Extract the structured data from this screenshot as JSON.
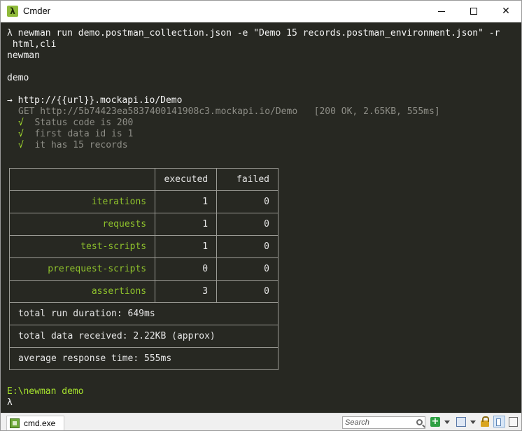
{
  "window": {
    "title": "Cmder",
    "app_icon_glyph": "λ",
    "controls": {
      "minimize": "minimize-icon",
      "maximize": "maximize-icon",
      "close": "close-icon"
    }
  },
  "console": {
    "prompt_glyph": "λ",
    "command_line1": "newman run demo.postman_collection.json -e \"Demo 15 records.postman_environment.json\" -r",
    "command_line2": " html,cli",
    "output_newman": "newman",
    "collection_name": "demo",
    "request_arrow": "→",
    "request_name": "http://{{url}}.mockapi.io/Demo",
    "request_detail": "GET http://5b74423ea5837400141908c3.mockapi.io/Demo   [200 OK, 2.65KB, 555ms]",
    "check_glyph": "√",
    "assertions": [
      "Status code is 200",
      "first data id is 1",
      "it has 15 records"
    ],
    "summary": {
      "headers": [
        "",
        "executed",
        "failed"
      ],
      "rows": [
        {
          "name": "iterations",
          "executed": "1",
          "failed": "0"
        },
        {
          "name": "requests",
          "executed": "1",
          "failed": "0"
        },
        {
          "name": "test-scripts",
          "executed": "1",
          "failed": "0"
        },
        {
          "name": "prerequest-scripts",
          "executed": "0",
          "failed": "0"
        },
        {
          "name": "assertions",
          "executed": "3",
          "failed": "0"
        }
      ],
      "total_run_duration": "total run duration: 649ms",
      "total_data_received": "total data received: 2.22KB (approx)",
      "average_response_time": "average response time: 555ms"
    },
    "final_path": "E:\\newman demo",
    "final_prompt": "λ"
  },
  "statusbar": {
    "tab_label": "cmd.exe",
    "search_placeholder": "Search",
    "new_console_glyph": "+"
  },
  "colors": {
    "console_bg": "#272822",
    "accent_green": "#a6e22e",
    "table_label_green": "#8fc22c"
  }
}
